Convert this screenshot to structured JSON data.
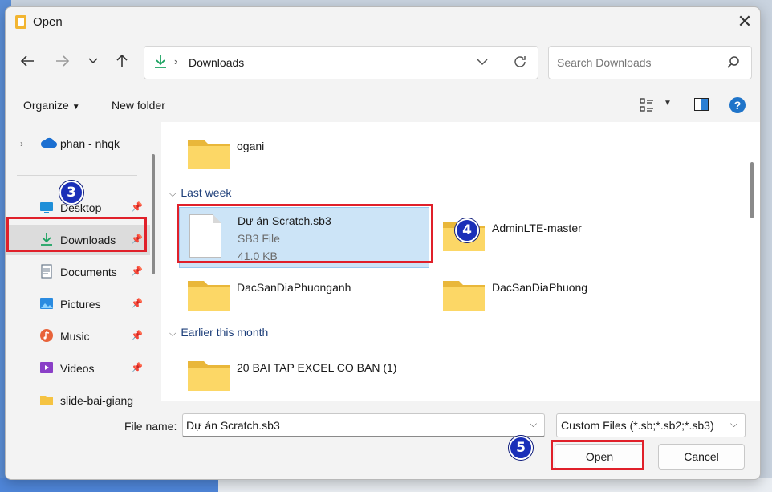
{
  "window": {
    "title": "Open"
  },
  "nav": {
    "path": "Downloads",
    "search_placeholder": "Search Downloads"
  },
  "toolbar": {
    "organize": "Organize",
    "new_folder": "New folder"
  },
  "sidebar": {
    "top": "phan - nhqk",
    "items": [
      {
        "label": "Desktop",
        "icon": "desktop-icon"
      },
      {
        "label": "Downloads",
        "icon": "download-icon"
      },
      {
        "label": "Documents",
        "icon": "documents-icon"
      },
      {
        "label": "Pictures",
        "icon": "pictures-icon"
      },
      {
        "label": "Music",
        "icon": "music-icon"
      },
      {
        "label": "Videos",
        "icon": "videos-icon"
      },
      {
        "label": "slide-bai-giang",
        "icon": "folder-icon"
      }
    ]
  },
  "main": {
    "top_folder": "ogani",
    "groups": [
      {
        "header": "Last week"
      },
      {
        "header": "Earlier this month"
      }
    ],
    "selected_file": {
      "name": "Dự án Scratch.sb3",
      "type": "SB3 File",
      "size": "41.0 KB"
    },
    "folders_last_week": [
      "AdminLTE-master",
      "DacSanDiaPhuonganh",
      "DacSanDiaPhuong"
    ],
    "folders_earlier": [
      "20 BAI TAP EXCEL CO BAN (1)"
    ]
  },
  "bottom": {
    "file_name_label": "File name:",
    "file_name_value": "Dự án Scratch.sb3",
    "filter": "Custom Files (*.sb;*.sb2;*.sb3)",
    "open": "Open",
    "cancel": "Cancel"
  },
  "annotations": {
    "badge3": "3",
    "badge4": "4",
    "badge5": "5"
  },
  "colors": {
    "accent": "#1f74c9",
    "highlight_red": "#e0202a",
    "badge_blue": "#1a2fb8",
    "selection": "#cce4f7"
  }
}
